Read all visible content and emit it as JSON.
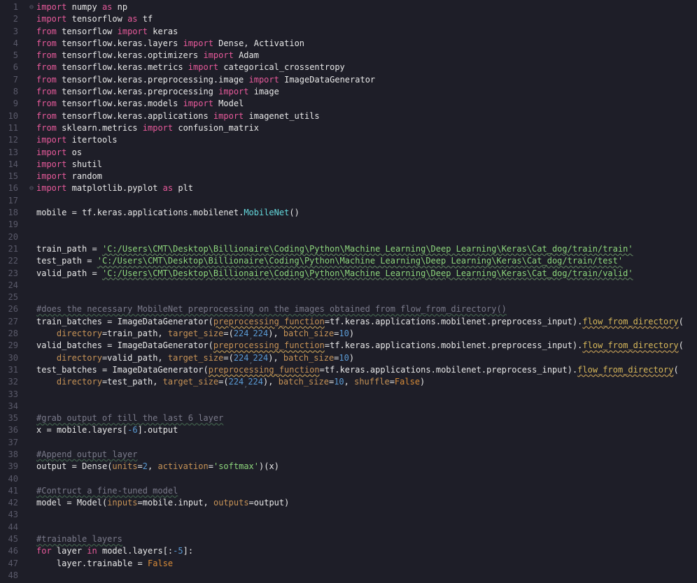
{
  "lines": [
    {
      "n": 1,
      "fold": "⊖",
      "html": "<span class='kw'>import</span> <span class='id'>numpy</span> <span class='kw'>as</span> <span class='id'>np</span>"
    },
    {
      "n": 2,
      "html": "<span class='kw'>import</span> <span class='id'>tensorflow</span> <span class='kw'>as</span> <span class='id'>tf</span>"
    },
    {
      "n": 3,
      "html": "<span class='kw'>from</span> <span class='id'>tensorflow</span> <span class='kw'>import</span> <span class='id'>keras</span>"
    },
    {
      "n": 4,
      "html": "<span class='kw'>from</span> <span class='id'>tensorflow</span><span class='op'>.</span><span class='id'>keras</span><span class='op'>.</span><span class='id'>layers</span> <span class='kw'>import</span> <span class='id'>Dense</span><span class='op'>,</span> <span class='id'>Activation</span>"
    },
    {
      "n": 5,
      "html": "<span class='kw'>from</span> <span class='id'>tensorflow</span><span class='op'>.</span><span class='id'>keras</span><span class='op'>.</span><span class='id'>optimizers</span> <span class='kw'>import</span> <span class='id'>Adam</span>"
    },
    {
      "n": 6,
      "html": "<span class='kw'>from</span> <span class='id'>tensorflow</span><span class='op'>.</span><span class='id'>keras</span><span class='op'>.</span><span class='id'>metrics</span> <span class='kw'>import</span> <span class='id'>categorical_crossentropy</span>"
    },
    {
      "n": 7,
      "html": "<span class='kw'>from</span> <span class='id'>tensorflow</span><span class='op'>.</span><span class='id'>keras</span><span class='op'>.</span><span class='id'>preprocessing</span><span class='op'>.</span><span class='id'>image</span> <span class='kw'>import</span> <span class='id'>ImageDataGenerator</span>"
    },
    {
      "n": 8,
      "html": "<span class='kw'>from</span> <span class='id'>tensorflow</span><span class='op'>.</span><span class='id'>keras</span><span class='op'>.</span><span class='id'>preprocessing</span> <span class='kw'>import</span> <span class='id'>image</span>"
    },
    {
      "n": 9,
      "html": "<span class='kw'>from</span> <span class='id'>tensorflow</span><span class='op'>.</span><span class='id'>keras</span><span class='op'>.</span><span class='id'>models</span> <span class='kw'>import</span> <span class='id'>Model</span>"
    },
    {
      "n": 10,
      "html": "<span class='kw'>from</span> <span class='id'>tensorflow</span><span class='op'>.</span><span class='id'>keras</span><span class='op'>.</span><span class='id'>applications</span> <span class='kw'>import</span> <span class='id'>imagenet_utils</span>"
    },
    {
      "n": 11,
      "html": "<span class='kw'>from</span> <span class='id'>sklearn</span><span class='op'>.</span><span class='id'>metrics</span> <span class='kw'>import</span> <span class='id'>confusion_matrix</span>"
    },
    {
      "n": 12,
      "html": "<span class='kw'>import</span> <span class='id'>itertools</span>"
    },
    {
      "n": 13,
      "html": "<span class='kw'>import</span> <span class='id'>os</span>"
    },
    {
      "n": 14,
      "html": "<span class='kw'>import</span> <span class='id'>shutil</span>"
    },
    {
      "n": 15,
      "html": "<span class='kw'>import</span> <span class='id'>random</span>"
    },
    {
      "n": 16,
      "fold": "⊖",
      "html": "<span class='kw'>import</span> <span class='id'>matplotlib</span><span class='op'>.</span><span class='id'>pyplot</span> <span class='kw'>as</span> <span class='id'>plt</span>"
    },
    {
      "n": 17,
      "html": ""
    },
    {
      "n": 18,
      "html": "<span class='id'>mobile</span> <span class='op'>=</span> <span class='id'>tf</span><span class='op'>.</span><span class='id'>keras</span><span class='op'>.</span><span class='id'>applications</span><span class='op'>.</span><span class='id'>mobilenet</span><span class='op'>.</span><span class='fn'>MobileNet</span><span class='op'>()</span>"
    },
    {
      "n": 19,
      "html": ""
    },
    {
      "n": 20,
      "html": ""
    },
    {
      "n": 21,
      "html": "<span class='id'>train_path</span> <span class='op'>=</span> <span class='strw'>'C:/Users\\CMT\\Desktop\\Billionaire\\Coding\\Python\\Machine Learning\\Deep Learning\\Keras\\Cat_dog/train/train'</span>"
    },
    {
      "n": 22,
      "html": "<span class='id'>test_path</span> <span class='op'>=</span> <span class='strw'>'C:/Users\\CMT\\Desktop\\Billionaire\\Coding\\Python\\Machine Learning\\Deep Learning\\Keras\\Cat_dog/train/test'</span>"
    },
    {
      "n": 23,
      "html": "<span class='id'>valid_path</span> <span class='op'>=</span> <span class='strw'>'C:/Users\\CMT\\Desktop\\Billionaire\\Coding\\Python\\Machine Learning\\Deep Learning\\Keras\\Cat_dog/train/valid'</span>"
    },
    {
      "n": 24,
      "html": ""
    },
    {
      "n": 25,
      "html": ""
    },
    {
      "n": 26,
      "html": "<span class='cmt'>#does the necessary MobileNet preprocessing on the images obtained from flow_from_directory()</span>"
    },
    {
      "n": 27,
      "html": "<span class='id'>train_batches</span> <span class='op'>=</span> <span class='id'>ImageDataGenerator</span><span class='op'>(</span><span class='param warn'>preprocessing_function</span><span class='op'>=</span><span class='id'>tf</span><span class='op'>.</span><span class='id'>keras</span><span class='op'>.</span><span class='id'>applications</span><span class='op'>.</span><span class='id'>mobilenet</span><span class='op'>.</span><span class='id'>preprocess_input</span><span class='op'>).</span><span class='yellow warn'>flow_from_directory</span><span class='op'>(</span>"
    },
    {
      "n": 28,
      "html": "    <span class='param'>directory</span><span class='op'>=</span><span class='id'>train_path</span><span class='op'>,</span> <span class='param'>target_size</span><span class='op'>=(</span><span class='num'>224</span><span class='smcom'>,</span><span class='num'>224</span><span class='op'>),</span> <span class='param'>batch_size</span><span class='op'>=</span><span class='num'>10</span><span class='op'>)</span>"
    },
    {
      "n": 29,
      "html": "<span class='id'>valid_batches</span> <span class='op'>=</span> <span class='id'>ImageDataGenerator</span><span class='op'>(</span><span class='param warn'>preprocessing_function</span><span class='op'>=</span><span class='id'>tf</span><span class='op'>.</span><span class='id'>keras</span><span class='op'>.</span><span class='id'>applications</span><span class='op'>.</span><span class='id'>mobilenet</span><span class='op'>.</span><span class='id'>preprocess_input</span><span class='op'>).</span><span class='yellow warn'>flow_from_directory</span><span class='op'>(</span>"
    },
    {
      "n": 30,
      "html": "    <span class='param'>directory</span><span class='op'>=</span><span class='id'>valid_path</span><span class='op'>,</span> <span class='param'>target_size</span><span class='op'>=(</span><span class='num'>224</span><span class='smcom'>,</span><span class='num'>224</span><span class='op'>),</span> <span class='param'>batch_size</span><span class='op'>=</span><span class='num'>10</span><span class='op'>)</span>"
    },
    {
      "n": 31,
      "html": "<span class='id'>test_batches</span> <span class='op'>=</span> <span class='id'>ImageDataGenerator</span><span class='op'>(</span><span class='param warn'>preprocessing_function</span><span class='op'>=</span><span class='id'>tf</span><span class='op'>.</span><span class='id'>keras</span><span class='op'>.</span><span class='id'>applications</span><span class='op'>.</span><span class='id'>mobilenet</span><span class='op'>.</span><span class='id'>preprocess_input</span><span class='op'>).</span><span class='yellow warn'>flow_from_directory</span><span class='op'>(</span>"
    },
    {
      "n": 32,
      "html": "    <span class='param'>directory</span><span class='op'>=</span><span class='id'>test_path</span><span class='op'>,</span> <span class='param'>target_size</span><span class='op'>=(</span><span class='num'>224</span><span class='smcom'>,</span><span class='num'>224</span><span class='op'>),</span> <span class='param'>batch_size</span><span class='op'>=</span><span class='num'>10</span><span class='op'>,</span> <span class='param'>shuffle</span><span class='op'>=</span><span class='bool'>False</span><span class='op'>)</span>"
    },
    {
      "n": 33,
      "html": ""
    },
    {
      "n": 34,
      "html": ""
    },
    {
      "n": 35,
      "html": "<span class='cmt'>#grab output of till the last 6 layer</span>"
    },
    {
      "n": 36,
      "html": "<span class='id'>x</span> <span class='op'>=</span> <span class='id'>mobile</span><span class='op'>.</span><span class='id'>layers</span><span class='op'>[</span><span class='num'>-6</span><span class='op'>].</span><span class='id'>output</span>"
    },
    {
      "n": 37,
      "html": ""
    },
    {
      "n": 38,
      "html": "<span class='cmt'>#Append output layer</span>"
    },
    {
      "n": 39,
      "html": "<span class='id'>output</span> <span class='op'>=</span> <span class='id'>Dense</span><span class='op'>(</span><span class='param'>units</span><span class='op'>=</span><span class='num'>2</span><span class='op'>,</span> <span class='param'>activation</span><span class='op'>=</span><span class='str'>'softmax'</span><span class='op'>)(</span><span class='id'>x</span><span class='op'>)</span>"
    },
    {
      "n": 40,
      "html": ""
    },
    {
      "n": 41,
      "html": "<span class='cmt'>#Contruct a fine-tuned model</span>"
    },
    {
      "n": 42,
      "html": "<span class='id'>model</span> <span class='op'>=</span> <span class='id'>Model</span><span class='op'>(</span><span class='param'>inputs</span><span class='op'>=</span><span class='id'>mobile</span><span class='op'>.</span><span class='id'>input</span><span class='op'>,</span> <span class='param'>outputs</span><span class='op'>=</span><span class='id'>output</span><span class='op'>)</span>"
    },
    {
      "n": 43,
      "html": ""
    },
    {
      "n": 44,
      "html": ""
    },
    {
      "n": 45,
      "html": "<span class='cmt'>#trainable layers</span>"
    },
    {
      "n": 46,
      "html": "<span class='kw'>for</span> <span class='id'>layer</span> <span class='kw'>in</span> <span class='id'>model</span><span class='op'>.</span><span class='id'>layers</span><span class='op'>[:</span><span class='num'>-5</span><span class='op'>]:</span>"
    },
    {
      "n": 47,
      "html": "    <span class='id'>layer</span><span class='op'>.</span><span class='id'>trainable</span> <span class='op'>=</span> <span class='bool'>False</span>"
    },
    {
      "n": 48,
      "html": ""
    }
  ]
}
